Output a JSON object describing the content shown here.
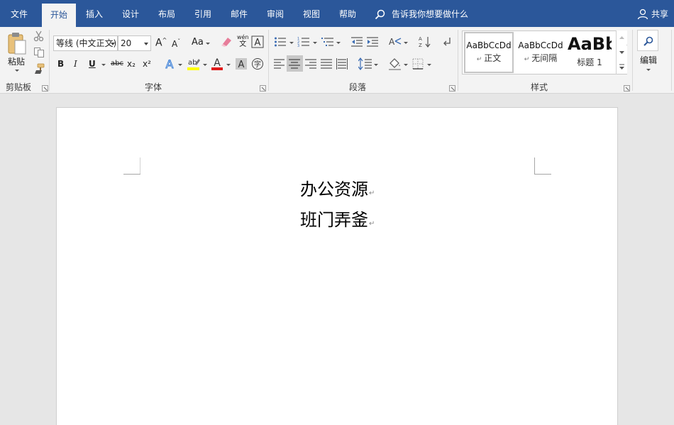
{
  "tabs": [
    {
      "id": "file",
      "label": "文件",
      "active": false
    },
    {
      "id": "home",
      "label": "开始",
      "active": true
    },
    {
      "id": "insert",
      "label": "插入",
      "active": false
    },
    {
      "id": "design",
      "label": "设计",
      "active": false
    },
    {
      "id": "layout",
      "label": "布局",
      "active": false
    },
    {
      "id": "references",
      "label": "引用",
      "active": false
    },
    {
      "id": "mailings",
      "label": "邮件",
      "active": false
    },
    {
      "id": "review",
      "label": "审阅",
      "active": false
    },
    {
      "id": "view",
      "label": "视图",
      "active": false
    },
    {
      "id": "help",
      "label": "帮助",
      "active": false
    }
  ],
  "tell_me": {
    "label": "告诉我你想要做什么",
    "icon": "lightbulb-search-icon"
  },
  "share": {
    "label": "共享",
    "icon": "person-icon"
  },
  "clipboard": {
    "paste_label": "粘贴",
    "group_label": "剪贴板",
    "icons": [
      "paste-icon",
      "cut-icon",
      "copy-icon",
      "format-painter-icon"
    ]
  },
  "font": {
    "font_name": "等线 (中文正文)",
    "font_size": "20",
    "group_label": "字体",
    "bold": "B",
    "italic": "I",
    "underline": "U",
    "strikethrough": "abc",
    "subscript": "x₂",
    "superscript": "x²",
    "change_case": "Aa",
    "font_color_hex": "#e01a1a",
    "highlight_color_hex": "#ffff00"
  },
  "paragraph": {
    "group_label": "段落"
  },
  "styles": {
    "group_label": "样式",
    "items": [
      {
        "preview": "AaBbCcDd",
        "name": "正文",
        "selected": true
      },
      {
        "preview": "AaBbCcDd",
        "name": "无间隔",
        "selected": false
      },
      {
        "preview": "AaBb",
        "name": "标题 1",
        "selected": false
      }
    ]
  },
  "editing": {
    "label": "编辑",
    "icon": "search-icon"
  },
  "document": {
    "lines": [
      "办公资源",
      "班门弄釜"
    ],
    "paragraph_mark": "↵"
  },
  "colors": {
    "title_bar": "#2b579a",
    "ribbon_bg": "#f3f3f3",
    "canvas_bg": "#e6e6e6",
    "page_bg": "#ffffff",
    "selected_button_bg": "#c8c8c8"
  }
}
